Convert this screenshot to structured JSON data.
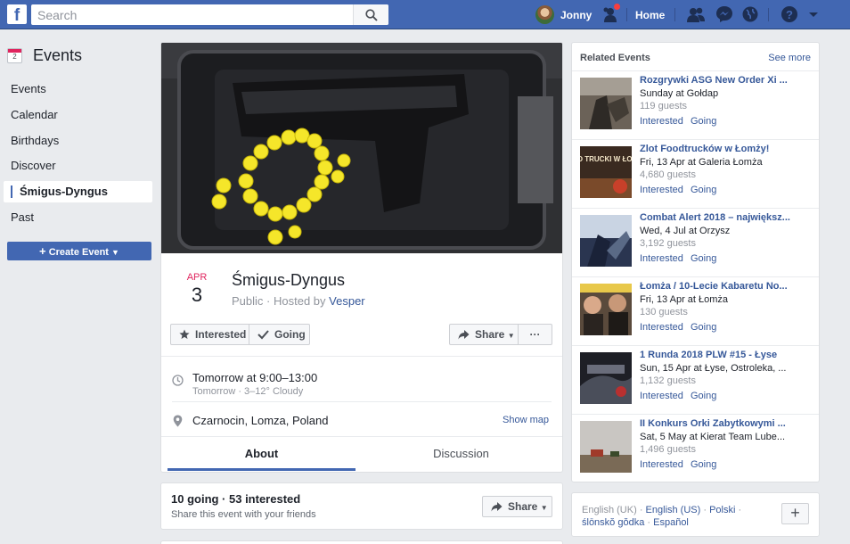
{
  "topbar": {
    "logo_letter": "f",
    "search_placeholder": "Search",
    "user_name": "Jonny",
    "home_label": "Home"
  },
  "sidebar": {
    "calendar_icon_day": "2",
    "title": "Events",
    "items": [
      {
        "label": "Events"
      },
      {
        "label": "Calendar"
      },
      {
        "label": "Birthdays"
      },
      {
        "label": "Discover"
      },
      {
        "label": "Śmigus-Dyngus",
        "active": true
      },
      {
        "label": "Past"
      }
    ],
    "create_label": "Create Event"
  },
  "event": {
    "month": "APR",
    "day": "3",
    "title": "Śmigus-Dyngus",
    "privacy": "Public",
    "hosted_by_prefix": "Hosted by",
    "host": "Vesper",
    "buttons": {
      "interested": "Interested",
      "going": "Going",
      "share": "Share",
      "more": "···"
    },
    "time": "Tomorrow at 9:00–13:00",
    "weather": "Tomorrow · 3–12° Cloudy",
    "location": "Czarnocin, Lomza, Poland",
    "show_map": "Show map",
    "tabs": [
      {
        "label": "About",
        "active": true
      },
      {
        "label": "Discussion"
      }
    ]
  },
  "attendance": {
    "summary": "10 going · 53 interested",
    "subtitle": "Share this event with your friends",
    "share": "Share"
  },
  "related": {
    "title": "Related Events",
    "see_more": "See more",
    "items": [
      {
        "name": "Rozgrywki ASG New Order Xi ...",
        "when": "Sunday at Gołdap",
        "guests": "119 guests",
        "interested": "Interested",
        "going": "Going"
      },
      {
        "name": "Zlot Foodtrucków w Łomży!",
        "when": "Fri, 13 Apr at Galeria Łomża",
        "guests": "4,680 guests",
        "interested": "Interested",
        "going": "Going",
        "thumb_text": "FOOD TRUCKI W ŁOMŻY!"
      },
      {
        "name": "Combat Alert 2018 – największ...",
        "when": "Wed, 4 Jul at Orzysz",
        "guests": "3,192 guests",
        "interested": "Interested",
        "going": "Going"
      },
      {
        "name": "Łomża / 10-Lecie Kabaretu No...",
        "when": "Fri, 13 Apr at Łomża",
        "guests": "130 guests",
        "interested": "Interested",
        "going": "Going"
      },
      {
        "name": "1 Runda 2018 PLW #15 - Łyse",
        "when": "Sun, 15 Apr at Łyse, Ostroleka, ...",
        "guests": "1,132 guests",
        "interested": "Interested",
        "going": "Going"
      },
      {
        "name": "II Konkurs Orki Zabytkowymi ...",
        "when": "Sat, 5 May at Kierat Team Lube...",
        "guests": "1,496 guests",
        "interested": "Interested",
        "going": "Going"
      }
    ]
  },
  "languages": {
    "current": "English (UK)",
    "links": [
      "English (US)",
      "Polski",
      "ślōnskŏ gŏdka",
      "Español"
    ],
    "more": "+"
  }
}
